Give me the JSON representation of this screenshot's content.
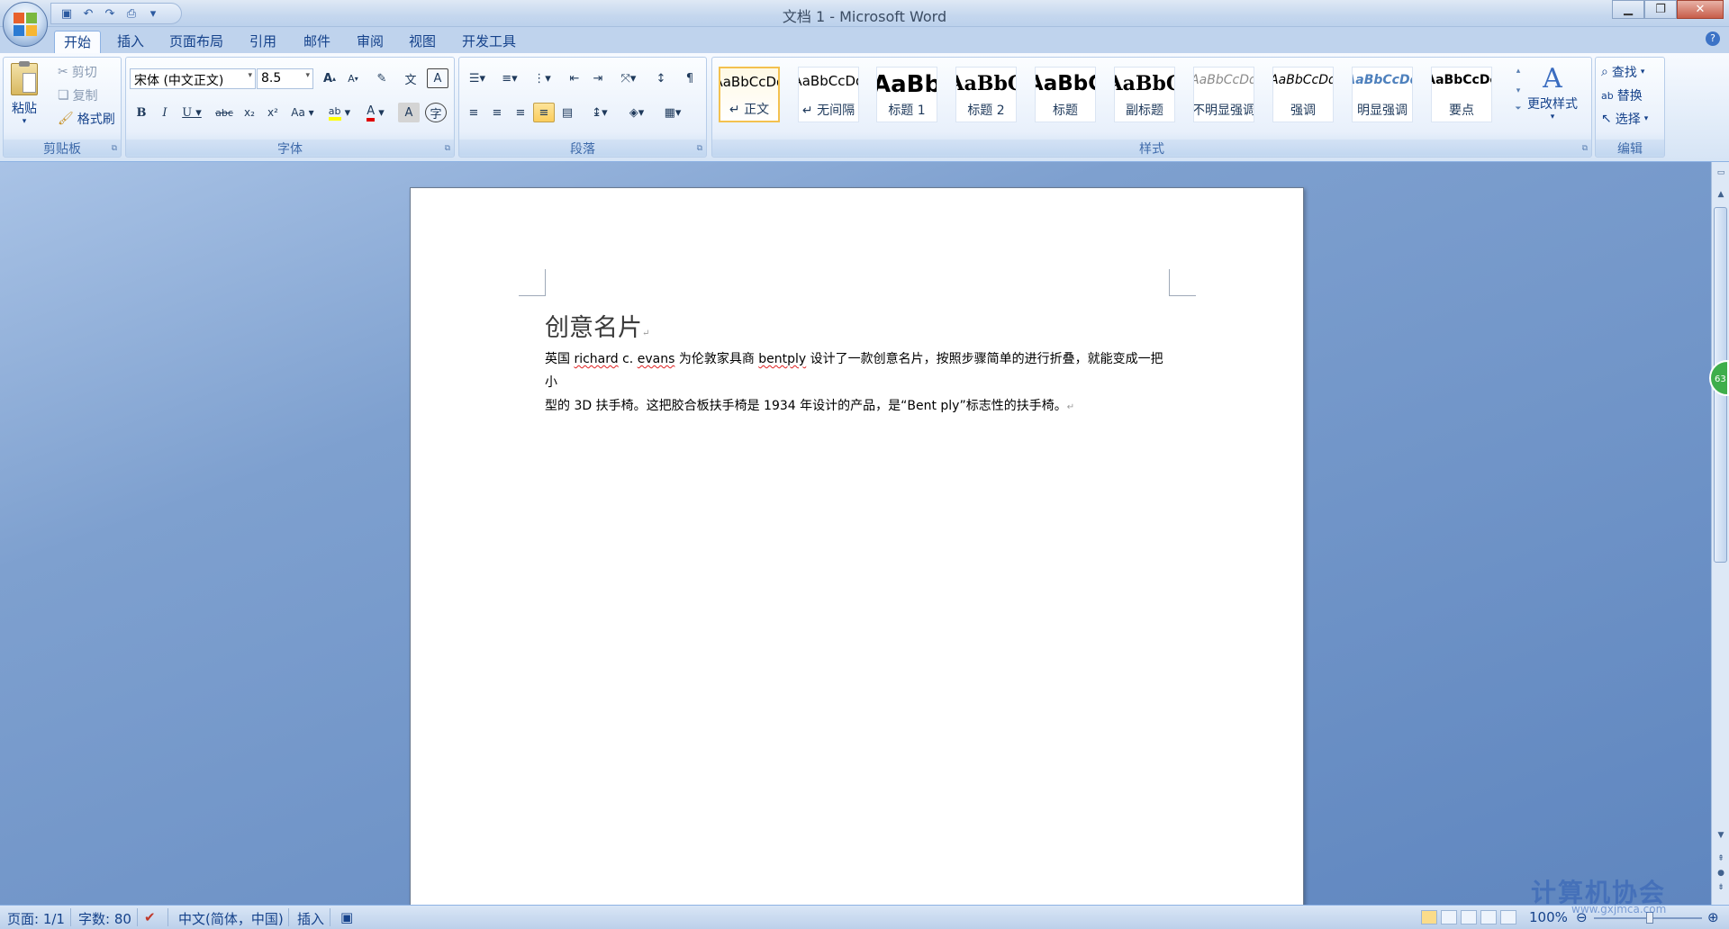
{
  "window": {
    "title": "文档 1 - Microsoft Word"
  },
  "tabs": [
    {
      "label": "开始"
    },
    {
      "label": "插入"
    },
    {
      "label": "页面布局"
    },
    {
      "label": "引用"
    },
    {
      "label": "邮件"
    },
    {
      "label": "审阅"
    },
    {
      "label": "视图"
    },
    {
      "label": "开发工具"
    }
  ],
  "clipboard": {
    "paste": "粘贴",
    "cut": "剪切",
    "copy": "复制",
    "format_painter": "格式刷",
    "label": "剪贴板"
  },
  "font": {
    "name": "宋体 (中文正文)",
    "size": "8.5",
    "label": "字体"
  },
  "paragraph": {
    "label": "段落"
  },
  "styles": {
    "label": "样式",
    "change_styles": "更改样式",
    "items": [
      {
        "sample": "AaBbCcDd",
        "name": "↵ 正文"
      },
      {
        "sample": "AaBbCcDd",
        "name": "↵ 无间隔"
      },
      {
        "sample": "AaBb",
        "name": "标题 1"
      },
      {
        "sample": "AaBbC",
        "name": "标题 2"
      },
      {
        "sample": "AaBbC",
        "name": "标题"
      },
      {
        "sample": "AaBbC",
        "name": "副标题"
      },
      {
        "sample": "AaBbCcDd",
        "name": "不明显强调"
      },
      {
        "sample": "AaBbCcDd",
        "name": "强调"
      },
      {
        "sample": "AaBbCcDd",
        "name": "明显强调"
      },
      {
        "sample": "AaBbCcDc",
        "name": "要点"
      }
    ]
  },
  "editing": {
    "find": "查找",
    "replace": "替换",
    "select": "选择",
    "label": "编辑"
  },
  "document": {
    "title": "创意名片",
    "line1_a": "英国 ",
    "line1_b": "richard",
    "line1_c": " c. ",
    "line1_d": "evans",
    "line1_e": " 为伦敦家具商 ",
    "line1_f": "bentply",
    "line1_g": " 设计了一款创意名片，按照步骤简单的进行折叠，就能变成一把小",
    "line2": "型的 3D 扶手椅。这把胶合板扶手椅是 1934 年设计的产品，是“Bent ply”标志性的扶手椅。"
  },
  "statusbar": {
    "page": "页面: 1/1",
    "words": "字数: 80",
    "language": "中文(简体，中国)",
    "mode": "插入",
    "zoom": "100%"
  },
  "side_badge": "63",
  "watermark": "计算机协会",
  "watermark_url": "www.gxjmca.com"
}
